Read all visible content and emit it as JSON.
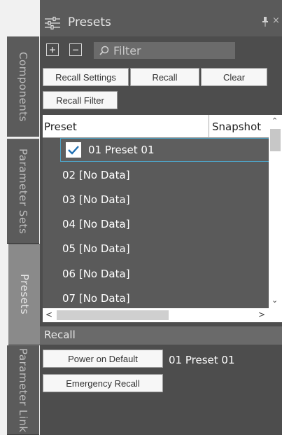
{
  "side_tabs": [
    "Components",
    "Parameter Sets",
    "Presets",
    "Parameter Link"
  ],
  "panel": {
    "title": "Presets",
    "pin_icon": "pin-icon",
    "close_icon": "close-icon"
  },
  "toolbar": {
    "add_label": "+",
    "remove_label": "−",
    "filter_placeholder": "Filter"
  },
  "buttons": {
    "recall_settings": "Recall Settings",
    "recall": "Recall",
    "clear": "Clear",
    "recall_filter": "Recall Filter",
    "power_on_default": "Power on Default",
    "emergency_recall": "Emergency Recall"
  },
  "grid": {
    "columns": [
      "Preset",
      "Snapshot"
    ],
    "rows": [
      {
        "label": "01 Preset 01",
        "checked": true
      },
      {
        "label": "02 [No Data]",
        "checked": false
      },
      {
        "label": "03 [No Data]",
        "checked": false
      },
      {
        "label": "04 [No Data]",
        "checked": false
      },
      {
        "label": "05 [No Data]",
        "checked": false
      },
      {
        "label": "06 [No Data]",
        "checked": false
      },
      {
        "label": "07 [No Data]",
        "checked": false
      }
    ]
  },
  "recall_section": {
    "title": "Recall",
    "power_on_value": "01 Preset 01"
  },
  "colors": {
    "panel_bg": "#4d4d4d",
    "selection_border": "#4ea3c6",
    "check_color": "#1f6fb2"
  }
}
